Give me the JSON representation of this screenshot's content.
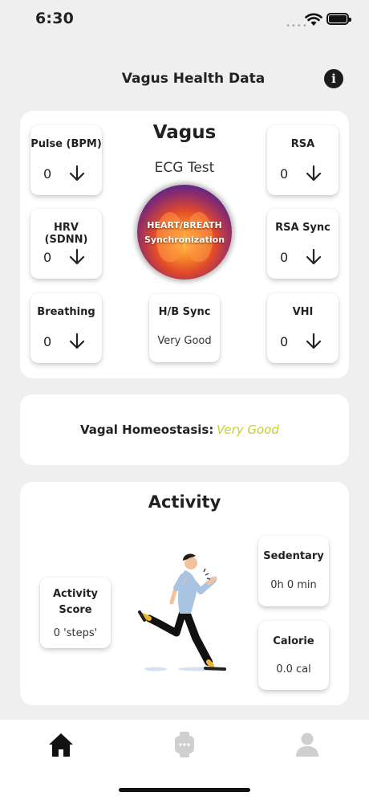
{
  "status_bar": {
    "time": "6:30"
  },
  "header": {
    "title": "Vagus Health Data",
    "info_icon": "info-icon"
  },
  "vagus_card": {
    "title": "Vagus",
    "subtitle": "ECG Test",
    "center_image": {
      "line1": "HEART/BREATH",
      "line2": "Synchronization"
    },
    "metrics": {
      "pulse": {
        "label": "Pulse (BPM)",
        "value": "0",
        "trend_icon": "arrow-down-icon"
      },
      "rsa": {
        "label": "RSA",
        "value": "0",
        "trend_icon": "arrow-down-icon"
      },
      "hrv": {
        "label": "HRV (SDNN)",
        "value": "0",
        "trend_icon": "arrow-down-icon"
      },
      "rsa_sync": {
        "label": "RSA Sync",
        "value": "0",
        "trend_icon": "arrow-down-icon"
      },
      "breathing": {
        "label": "Breathing",
        "value": "0",
        "trend_icon": "arrow-down-icon"
      },
      "vhi": {
        "label": "VHI",
        "value": "0",
        "trend_icon": "arrow-down-icon"
      },
      "hb_sync": {
        "label": "H/B Sync",
        "value": "Very Good"
      }
    }
  },
  "homeostasis": {
    "label": "Vagal Homeostasis:",
    "value": "Very Good",
    "value_color": "#c4d12c"
  },
  "activity": {
    "title": "Activity",
    "score": {
      "label_line1": "Activity",
      "label_line2": "Score",
      "value": "0 'steps'"
    },
    "sedentary": {
      "label": "Sedentary",
      "value": "0h 0 min"
    },
    "calorie": {
      "label": "Calorie",
      "value": "0.0 cal"
    }
  },
  "tab_bar": {
    "tabs": [
      {
        "icon": "home-icon",
        "active": true
      },
      {
        "icon": "watch-icon",
        "active": false
      },
      {
        "icon": "profile-icon",
        "active": false
      }
    ]
  }
}
